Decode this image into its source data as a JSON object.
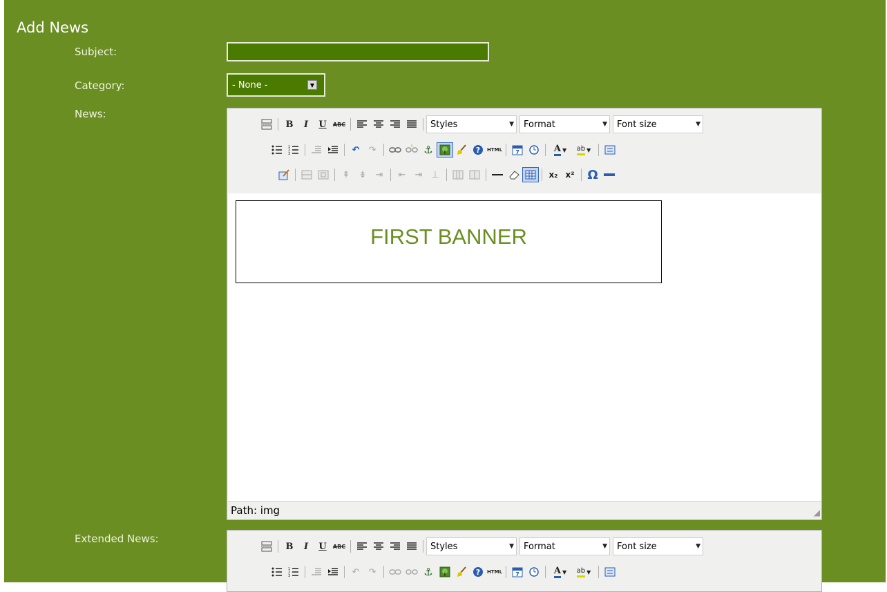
{
  "page_title": "Add News",
  "labels": {
    "subject": "Subject:",
    "category": "Category:",
    "news": "News:",
    "extended_news": "Extended News:"
  },
  "subject": {
    "value": ""
  },
  "category": {
    "selected": "- None -"
  },
  "editor": {
    "dropdowns": {
      "styles": "Styles",
      "format": "Format",
      "font_size": "Font size"
    },
    "icons": {
      "bold": "B",
      "italic": "I",
      "underline": "U",
      "strike": "ABC",
      "html": "HTML",
      "color": "A",
      "highlight": "ab",
      "omega": "Ω",
      "subscript": "x₂",
      "superscript": "x²"
    },
    "banner_text": "FIRST BANNER",
    "path_label": "Path: img"
  },
  "colors": {
    "background": "#6b8e23",
    "input_bg": "#4a7a00",
    "banner_text": "#6b8e23"
  }
}
